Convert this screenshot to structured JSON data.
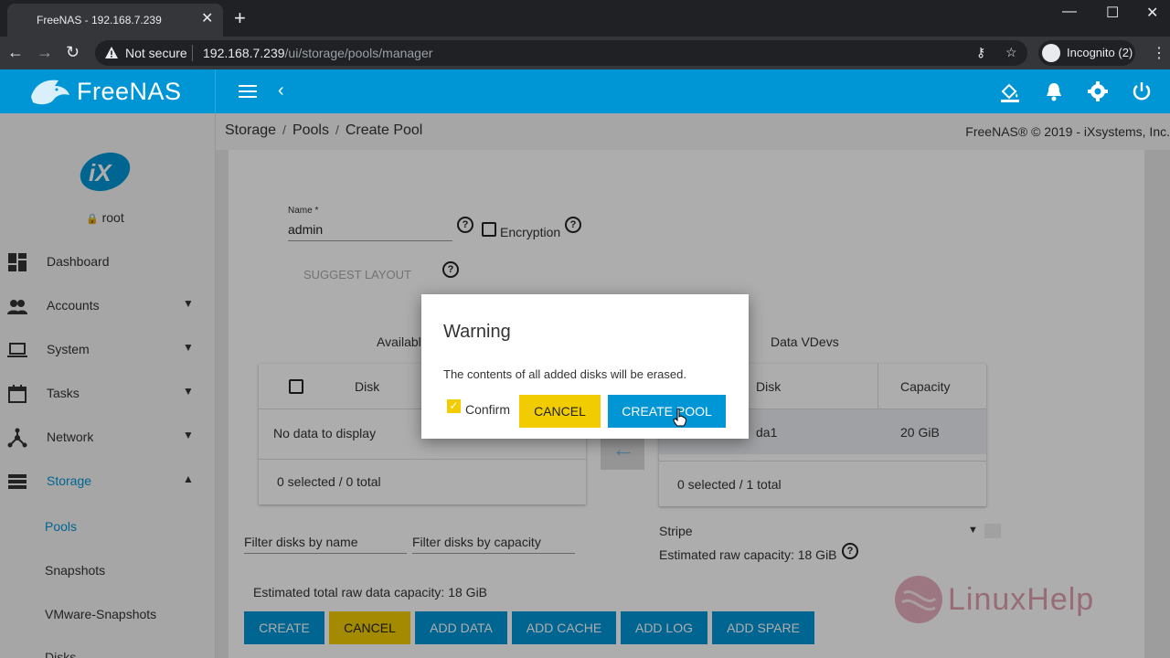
{
  "browser": {
    "tab_title": "FreeNAS - 192.168.7.239",
    "security_label": "Not secure",
    "url_host": "192.168.7.239",
    "url_path": "/ui/storage/pools/manager",
    "incognito_label": "Incognito (2)"
  },
  "app": {
    "logo_text": "FreeNAS",
    "brand_color": "#0095d5",
    "accent_yellow": "#f0cc00"
  },
  "sidebar": {
    "user": "root",
    "items": [
      {
        "label": "Dashboard",
        "icon": "dashboard-icon"
      },
      {
        "label": "Accounts",
        "icon": "people-icon"
      },
      {
        "label": "System",
        "icon": "laptop-icon"
      },
      {
        "label": "Tasks",
        "icon": "calendar-icon"
      },
      {
        "label": "Network",
        "icon": "network-icon"
      },
      {
        "label": "Storage",
        "icon": "storage-icon"
      }
    ],
    "storage_sub": [
      "Pools",
      "Snapshots",
      "VMware-Snapshots",
      "Disks"
    ]
  },
  "breadcrumb": [
    "Storage",
    "Pools",
    "Create Pool"
  ],
  "copyright": "FreeNAS® © 2019 - iXsystems, Inc.",
  "form": {
    "name_label": "Name *",
    "name_value": "admin",
    "encryption_label": "Encryption",
    "suggest_layout": "SUGGEST LAYOUT"
  },
  "available": {
    "title": "Available Disks",
    "col_disk": "Disk",
    "empty": "No data to display",
    "footer": "0 selected / 0 total",
    "filter_name": "Filter disks by name",
    "filter_capacity": "Filter disks by capacity"
  },
  "vdevs": {
    "title": "Data VDevs",
    "col_disk": "Disk",
    "col_capacity": "Capacity",
    "rows": [
      {
        "disk": "da1",
        "capacity": "20 GiB"
      }
    ],
    "footer": "0 selected / 1 total",
    "layout": "Stripe",
    "raw_capacity": "Estimated raw capacity: 18 GiB"
  },
  "total_capacity": "Estimated total raw data capacity: 18 GiB",
  "actions": [
    "CREATE",
    "CANCEL",
    "ADD DATA",
    "ADD CACHE",
    "ADD LOG",
    "ADD SPARE"
  ],
  "dialog": {
    "title": "Warning",
    "message": "The contents of all added disks will be erased.",
    "confirm_label": "Confirm",
    "cancel": "CANCEL",
    "create": "CREATE POOL"
  },
  "watermark": "LinuxHelp"
}
